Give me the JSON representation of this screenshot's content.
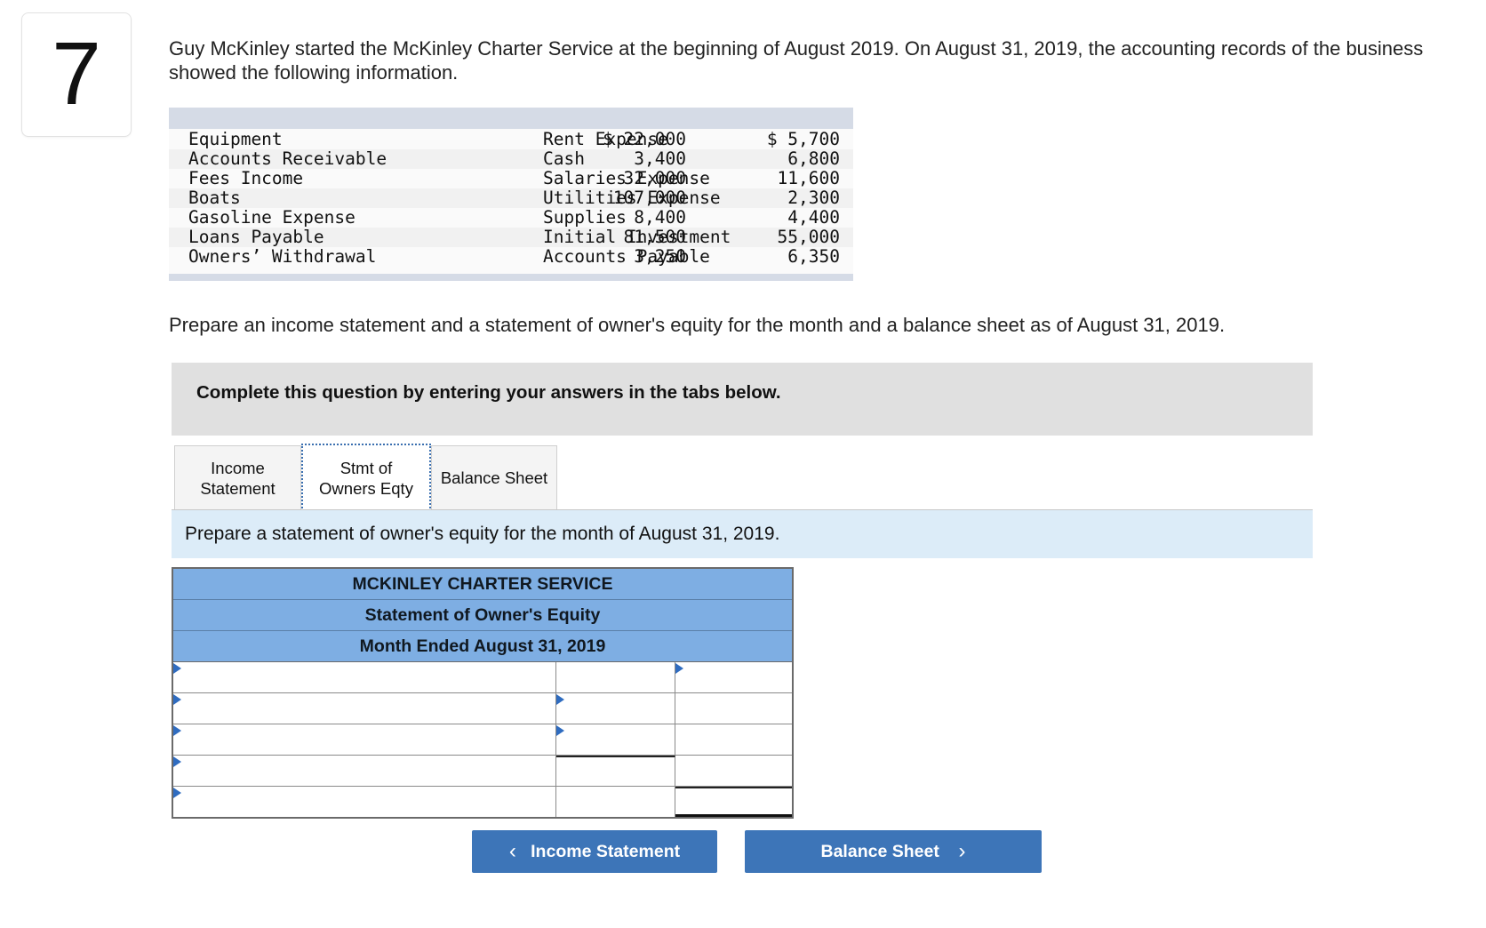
{
  "question": {
    "number": "7",
    "intro": "Guy McKinley started the McKinley Charter Service at the beginning of August 2019. On August 31, 2019, the accounting records of the business showed the following information."
  },
  "accounts": [
    {
      "left_name": "Equipment",
      "left_amount": "$ 22,000",
      "right_name": "Rent Expense",
      "right_amount": "$ 5,700"
    },
    {
      "left_name": "Accounts Receivable",
      "left_amount": "3,400",
      "right_name": "Cash",
      "right_amount": "6,800"
    },
    {
      "left_name": "Fees Income",
      "left_amount": "32,000",
      "right_name": "Salaries Expense",
      "right_amount": "11,600"
    },
    {
      "left_name": "Boats",
      "left_amount": "107,000",
      "right_name": "Utilities Expense",
      "right_amount": "2,300"
    },
    {
      "left_name": "Gasoline Expense",
      "left_amount": "8,400",
      "right_name": "Supplies",
      "right_amount": "4,400"
    },
    {
      "left_name": "Loans Payable",
      "left_amount": "81,500",
      "right_name": "Initial Investment",
      "right_amount": "55,000"
    },
    {
      "left_name": "Owners’ Withdrawal",
      "left_amount": "3,250",
      "right_name": "Accounts Payable",
      "right_amount": "6,350"
    }
  ],
  "prepare_text": "Prepare an income statement and a statement of owner's equity for the month and a balance sheet as of August 31, 2019.",
  "complete_text": "Complete this question by entering your answers in the tabs below.",
  "tabs": [
    {
      "line1": "Income",
      "line2": "Statement"
    },
    {
      "line1": "Stmt of",
      "line2": "Owners Eqty"
    },
    {
      "line1": "Balance Sheet",
      "line2": ""
    }
  ],
  "instruction": "Prepare a statement of owner's equity for the month of August 31, 2019.",
  "statement": {
    "company": "MCKINLEY CHARTER SERVICE",
    "title": "Statement of Owner's Equity",
    "period": "Month Ended August 31, 2019"
  },
  "nav": {
    "prev_label": "Income Statement",
    "next_label": "Balance Sheet"
  }
}
